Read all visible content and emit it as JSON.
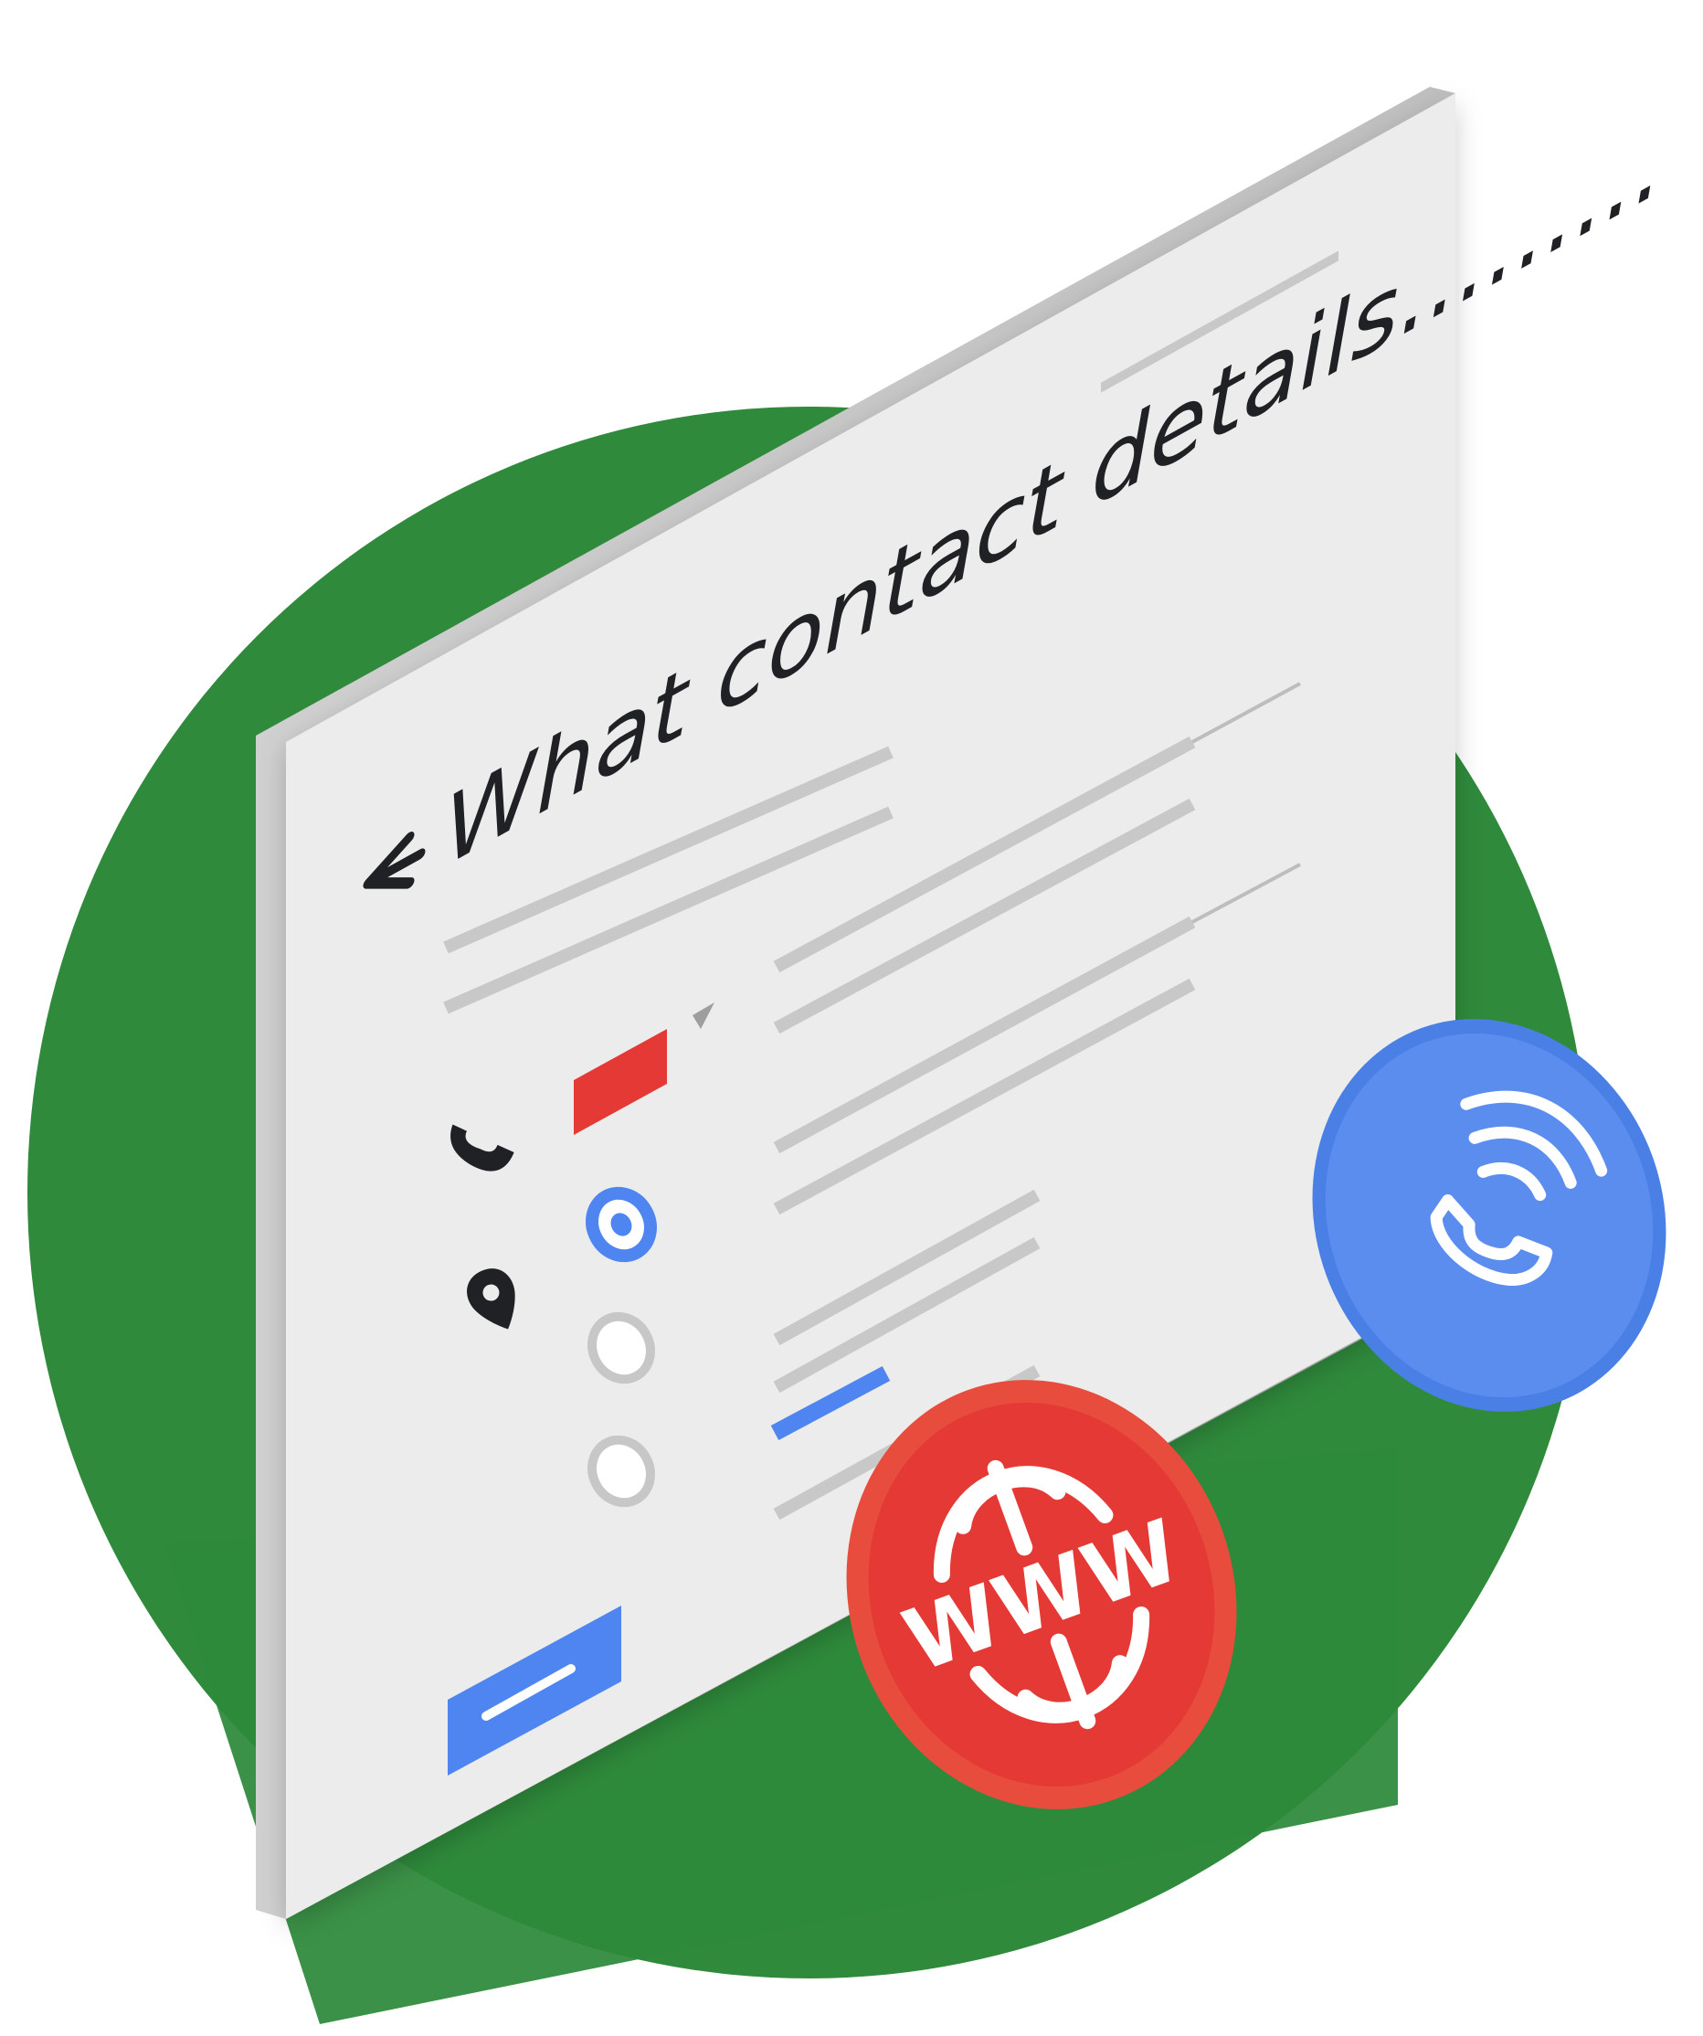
{
  "card": {
    "title": "What contact details.........",
    "back_icon": "arrow-left-icon"
  },
  "form": {
    "contact_icons": [
      "phone-icon",
      "location-pin-icon"
    ],
    "dropdown_icon": "triangle-down-icon",
    "radio_options": [
      {
        "selected": true
      },
      {
        "selected": false
      },
      {
        "selected": false
      }
    ]
  },
  "badges": [
    {
      "icon": "globe-www-icon",
      "text": "WWW",
      "color": "#e74c3c"
    },
    {
      "icon": "phone-call-icon",
      "color": "#5b8def"
    }
  ],
  "colors": {
    "background_green": "#2f8a3c",
    "card": "#ececec",
    "placeholder_line": "#c8c8c8",
    "blue_accent": "#4f85f0",
    "red_accent": "#e53935"
  }
}
